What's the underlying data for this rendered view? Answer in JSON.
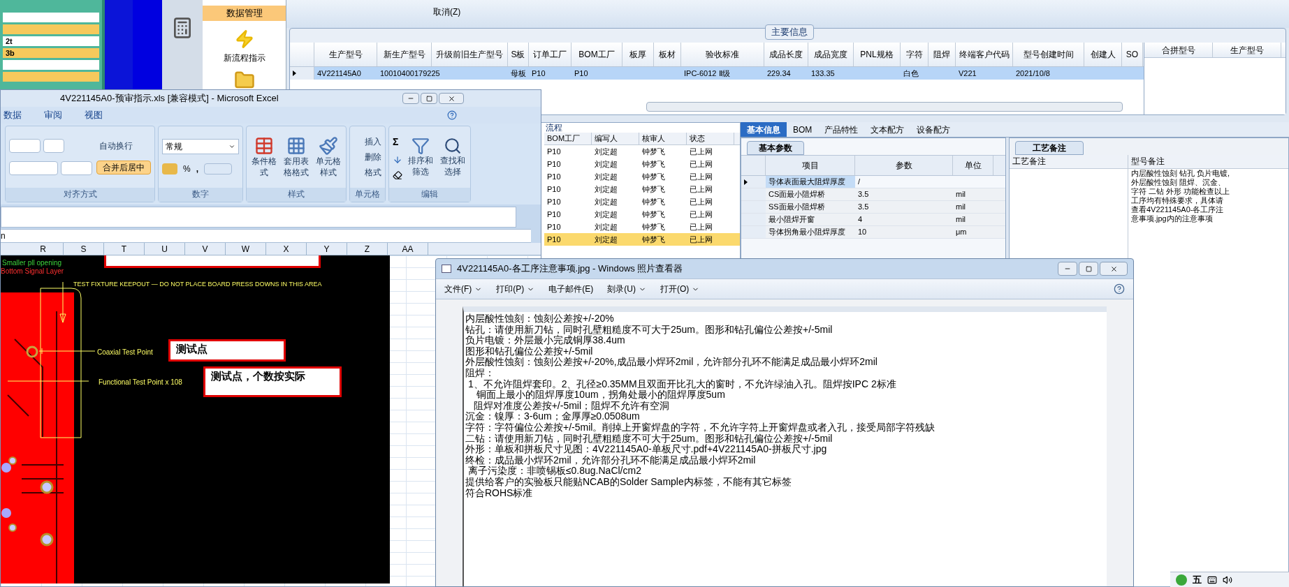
{
  "game_window": {
    "labels": [
      "2t",
      "3b"
    ]
  },
  "erp": {
    "toolbar": {
      "cancel": "取消(Z)"
    },
    "nav": {
      "header": "数据管理",
      "items": [
        {
          "label": "新流程指示"
        }
      ]
    },
    "main_info": {
      "title": "主要信息",
      "columns": [
        "生产型号",
        "新生产型号",
        "升级前旧生产型号",
        "S板",
        "订单工厂",
        "BOM工厂",
        "板厚",
        "板材",
        "验收标准",
        "成品长度",
        "成品宽度",
        "PNL规格",
        "字符",
        "阻焊",
        "终端客户代码",
        "型号创建时间",
        "创建人",
        "SO"
      ],
      "rows": [
        {
          "selected": true,
          "cells": [
            "4V221145A0",
            "10010400179225",
            "",
            "母板",
            "P10",
            "P10",
            "",
            "",
            "IPC-6012 Ⅱ级",
            "229.34",
            "133.35",
            "",
            "白色",
            "",
            "V221",
            "2021/10/8",
            "",
            ""
          ]
        }
      ]
    },
    "merge_panel": {
      "columns": [
        "合拼型号",
        "生产型号"
      ]
    },
    "process_list": {
      "tab": "流程",
      "columns": [
        "BOM工厂",
        "编写人",
        "核审人",
        "状态"
      ],
      "rows": [
        {
          "selected": false,
          "cells": [
            "P10",
            "刘定超",
            "钟梦飞",
            "已上网"
          ]
        },
        {
          "selected": false,
          "cells": [
            "P10",
            "刘定超",
            "钟梦飞",
            "已上网"
          ]
        },
        {
          "selected": false,
          "cells": [
            "P10",
            "刘定超",
            "钟梦飞",
            "已上网"
          ]
        },
        {
          "selected": false,
          "cells": [
            "P10",
            "刘定超",
            "钟梦飞",
            "已上网"
          ]
        },
        {
          "selected": false,
          "cells": [
            "P10",
            "刘定超",
            "钟梦飞",
            "已上网"
          ]
        },
        {
          "selected": false,
          "cells": [
            "P10",
            "刘定超",
            "钟梦飞",
            "已上网"
          ]
        },
        {
          "selected": false,
          "cells": [
            "P10",
            "刘定超",
            "钟梦飞",
            "已上网"
          ]
        },
        {
          "selected": true,
          "cells": [
            "P10",
            "刘定超",
            "钟梦飞",
            "已上网"
          ]
        }
      ]
    },
    "detail_tabs": [
      {
        "label": "基本信息",
        "selected": true
      },
      {
        "label": "BOM",
        "selected": false
      },
      {
        "label": "产品特性",
        "selected": false
      },
      {
        "label": "文本配方",
        "selected": false
      },
      {
        "label": "设备配方",
        "selected": false
      }
    ],
    "basic_params": {
      "tab": "基本参数",
      "columns": [
        "项目",
        "参数",
        "单位"
      ],
      "rows": [
        {
          "selected": true,
          "cells": [
            "导体表面最大阻焊厚度",
            "/",
            ""
          ]
        },
        {
          "selected": false,
          "cells": [
            "CS面最小阻焊桥",
            "3.5",
            "mil"
          ]
        },
        {
          "selected": false,
          "cells": [
            "SS面最小阻焊桥",
            "3.5",
            "mil"
          ]
        },
        {
          "selected": false,
          "cells": [
            "最小阻焊开窗",
            "4",
            "mil"
          ]
        },
        {
          "selected": false,
          "cells": [
            "导体拐角最小阻焊厚度",
            "10",
            "μm"
          ]
        }
      ]
    },
    "notes": {
      "tab": "工艺备注",
      "columns": [
        "工艺备注",
        "型号备注"
      ],
      "model_note": "内层酸性蚀刻 钻孔 负片电镀,外层酸性蚀刻 阻焊、沉金、字符 二钻 外形 功能检查以上工序均有特殊要求，具体请查看4V221145A0-各工序注意事项.jpg内的注意事项"
    }
  },
  "excel": {
    "title": "4V221145A0-预审指示.xls  [兼容模式] - Microsoft Excel",
    "tabs": [
      {
        "label": "数据",
        "selected": false
      },
      {
        "label": "审阅",
        "selected": false
      },
      {
        "label": "视图",
        "selected": false
      }
    ],
    "groups": [
      {
        "kind": "align",
        "label": "对齐方式",
        "wrap": "自动换行",
        "merge": "合并后居中",
        "merge_on": true
      },
      {
        "kind": "number",
        "label": "数字",
        "format": "常规",
        "percent": "%",
        "comma": ","
      },
      {
        "kind": "styles",
        "label": "样式",
        "buttons": [
          "条件格式",
          "套用表格格式",
          "单元格样式"
        ]
      },
      {
        "kind": "cells",
        "label": "单元格",
        "buttons": [
          "插入",
          "删除",
          "格式"
        ]
      },
      {
        "kind": "edit",
        "label": "编辑",
        "sigma": "Σ",
        "buttons": [
          "排序和筛选",
          "查找和选择"
        ]
      }
    ],
    "name_box": "n",
    "columns": [
      "R",
      "S",
      "T",
      "U",
      "V",
      "W",
      "X",
      "Y",
      "Z",
      "AA"
    ],
    "cad": {
      "legend": [
        "Smaller pll opening",
        "Bottom Signal Layer"
      ],
      "keepout": "TEST FIXTURE KEEPOUT — DO NOT PLACE BOARD PRESS DOWNS IN THIS AREA",
      "coax": "Coaxial Test Point",
      "functional": "Functional Test Point x 108",
      "callouts": [
        "测试点",
        "测试点，个数按实际"
      ]
    }
  },
  "photo_viewer": {
    "title": "4V221145A0-各工序注意事项.jpg - Windows 照片查看器",
    "menu": [
      {
        "label": "文件(F)",
        "dropdown": true
      },
      {
        "label": "打印(P)",
        "dropdown": true
      },
      {
        "label": "电子邮件(E)",
        "dropdown": false
      },
      {
        "label": "刻录(U)",
        "dropdown": true
      },
      {
        "label": "打开(O)",
        "dropdown": true
      }
    ],
    "lines": [
      "内层酸性蚀刻：蚀刻公差按+/-20%",
      "钻孔：请使用新刀钻，同时孔壁粗糙度不可大于25um。图形和钻孔偏位公差按+/-5mil",
      "负片电镀：外层最小完成铜厚38.4um",
      "图形和钻孔偏位公差按+/-5mil",
      "外层酸性蚀刻：蚀刻公差按+/-20%,成品最小焊环2mil，允许部分孔环不能满足成品最小焊环2mil",
      "阻焊：",
      " 1、不允许阻焊套印。2、孔径≥0.35MM且双面开比孔大的窗时，不允许绿油入孔。阻焊按IPC 2标准",
      "    铜面上最小的阻焊厚度10um，拐角处最小的阻焊厚度5um",
      "   阻焊对准度公差按+/-5mil；阻焊不允许有空洞",
      "沉金：镍厚：3-6um；金厚厚≥0.0508um",
      "字符：字符偏位公差按+/-5mil。削掉上开窗焊盘的字符，不允许字符上开窗焊盘或者入孔，接受局部字符残缺",
      "二钻：请使用新刀钻，同时孔壁粗糙度不可大于25um。图形和钻孔偏位公差按+/-5mil",
      "外形：单板和拼板尺寸见图：4V221145A0-单板尺寸.pdf+4V221145A0-拼板尺寸.jpg",
      "终检：成品最小焊环2mil，允许部分孔环不能满足成品最小焊环2mil",
      " 离子污染度：非喷锡板≤0.8ug.NaCl/cm2",
      "提供给客户的实验板只能贴NCAB的Solder Sample内标签，不能有其它标签",
      "符合ROHS标准"
    ]
  },
  "tray": {
    "ime": "五"
  }
}
